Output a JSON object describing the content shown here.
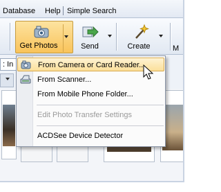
{
  "menubar": {
    "items": [
      {
        "label": "Database",
        "underline": "D"
      },
      {
        "label": "Help",
        "underline": "H"
      },
      {
        "label": "Simple Search"
      }
    ]
  },
  "toolbar": {
    "buttons": [
      {
        "label": "Get Photos",
        "icon": "camera-icon",
        "active": true
      },
      {
        "label": "Send",
        "icon": "send-arrow-icon"
      },
      {
        "label": "Create",
        "icon": "magic-wand-icon"
      }
    ]
  },
  "address": {
    "text": ": In"
  },
  "dropdown": {
    "items": [
      {
        "label": "From Camera or Card Reader...",
        "highlighted": true,
        "icon": "camera-icon"
      },
      {
        "label": "From Scanner...",
        "icon": "scanner-icon"
      },
      {
        "label": "From Mobile Phone Folder..."
      },
      {
        "label": "Edit Photo Transfer Settings",
        "disabled": true
      },
      {
        "label": "ACDSee Device Detector"
      }
    ]
  },
  "colors": {
    "accent": "#f9c35a",
    "highlight": "#fbdf9a",
    "menubar": "#e3e9f3"
  }
}
